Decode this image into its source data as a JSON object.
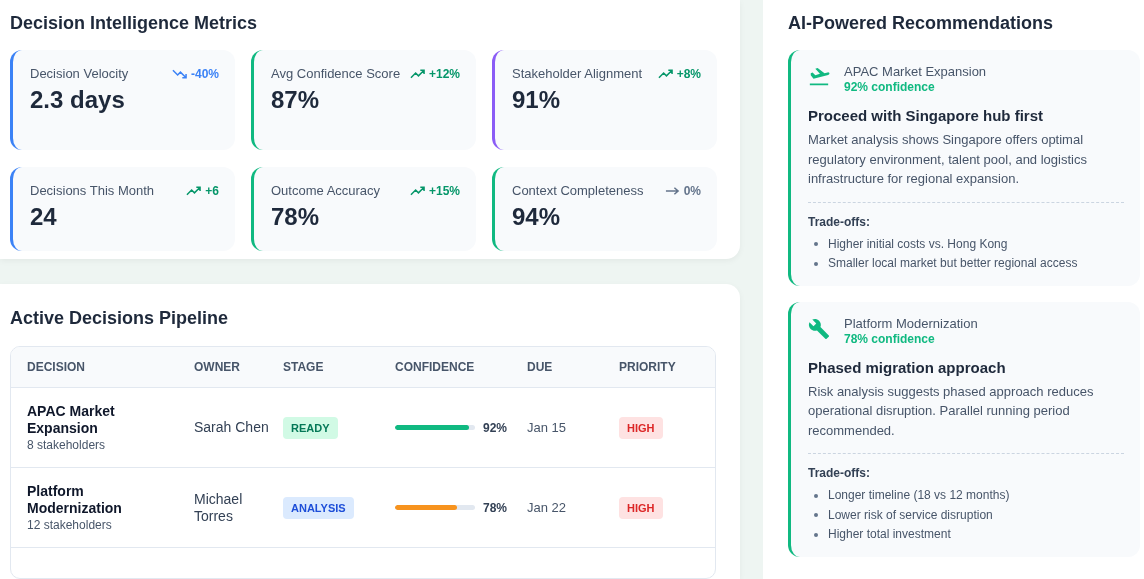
{
  "metrics_panel": {
    "title": "Decision Intelligence Metrics",
    "metrics": [
      {
        "label": "Decision Velocity",
        "value": "2.3 days",
        "change": "-40%",
        "kind": "down",
        "color": "#3b82f6"
      },
      {
        "label": "Avg Confidence Score",
        "value": "87%",
        "change": "+12%",
        "kind": "up",
        "color": "#10b981"
      },
      {
        "label": "Stakeholder Alignment",
        "value": "91%",
        "change": "+8%",
        "kind": "up",
        "color": "#8b5cf6"
      },
      {
        "label": "Decisions This Month",
        "value": "24",
        "change": "+6",
        "kind": "up",
        "color": "#3b82f6"
      },
      {
        "label": "Outcome Accuracy",
        "value": "78%",
        "change": "+15%",
        "kind": "up",
        "color": "#10b981"
      },
      {
        "label": "Context Completeness",
        "value": "94%",
        "change": "0%",
        "kind": "flat",
        "color": "#10b981"
      }
    ]
  },
  "pipeline": {
    "title": "Active Decisions Pipeline",
    "columns": [
      "DECISION",
      "OWNER",
      "STAGE",
      "CONFIDENCE",
      "DUE",
      "PRIORITY"
    ],
    "rows": [
      {
        "decision": "APAC Market Expansion",
        "stakeholders": "8 stakeholders",
        "owner": "Sarah Chen",
        "stage": "READY",
        "kind": "ready",
        "level": 0.92,
        "confidence": "92%",
        "color": "#10b981",
        "due": "Jan 15",
        "priority": "HIGH"
      },
      {
        "decision": "Platform Modernization",
        "stakeholders": "12 stakeholders",
        "owner": "Michael Torres",
        "stage": "ANALYSIS",
        "kind": "analysis",
        "level": 0.78,
        "confidence": "78%",
        "color": "#f7931e",
        "due": "Jan 22",
        "priority": "HIGH"
      }
    ]
  },
  "recommendations": {
    "title": "AI-Powered Recommendations",
    "items": [
      {
        "kind": "plane",
        "topic": "APAC Market Expansion",
        "confidence": "92% confidence",
        "headline": "Proceed with Singapore hub first",
        "body": "Market analysis shows Singapore offers optimal regulatory environment, talent pool, and logistics infrastructure for regional expansion.",
        "tradeoffs_label": "Trade-offs:",
        "tradeoffs": [
          "Higher initial costs vs. Hong Kong",
          "Smaller local market but better regional access"
        ]
      },
      {
        "kind": "wrench",
        "topic": "Platform Modernization",
        "confidence": "78% confidence",
        "headline": "Phased migration approach",
        "body": "Risk analysis suggests phased approach reduces operational disruption. Parallel running period recommended.",
        "tradeoffs_label": "Trade-offs:",
        "tradeoffs": [
          "Longer timeline (18 vs 12 months)",
          "Lower risk of service disruption",
          "Higher total investment"
        ]
      }
    ]
  }
}
